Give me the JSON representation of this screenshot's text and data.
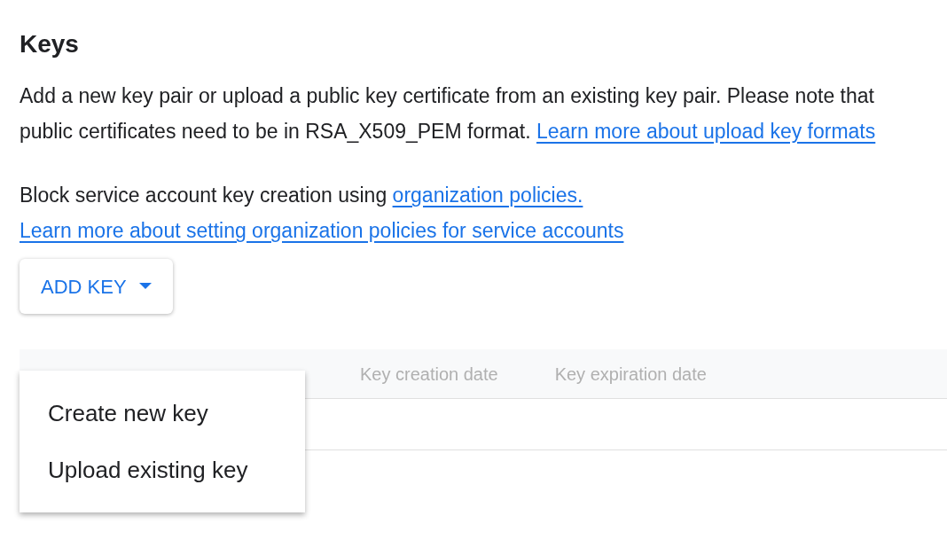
{
  "title": "Keys",
  "intro": {
    "text": "Add a new key pair or upload a public key certificate from an existing key pair. Please note that public certificates need to be in RSA_X509_PEM format.",
    "link": "Learn more about upload key formats"
  },
  "policy": {
    "text": "Block service account key creation using",
    "link": "organization policies.",
    "second_link": "Learn more about setting organization policies for service accounts"
  },
  "add_key_button": {
    "label": "ADD KEY",
    "expanded": true
  },
  "menu": [
    {
      "label": "Create new key"
    },
    {
      "label": "Upload existing key"
    }
  ],
  "table": {
    "columns": [
      "Key creation date",
      "Key expiration date"
    ]
  }
}
